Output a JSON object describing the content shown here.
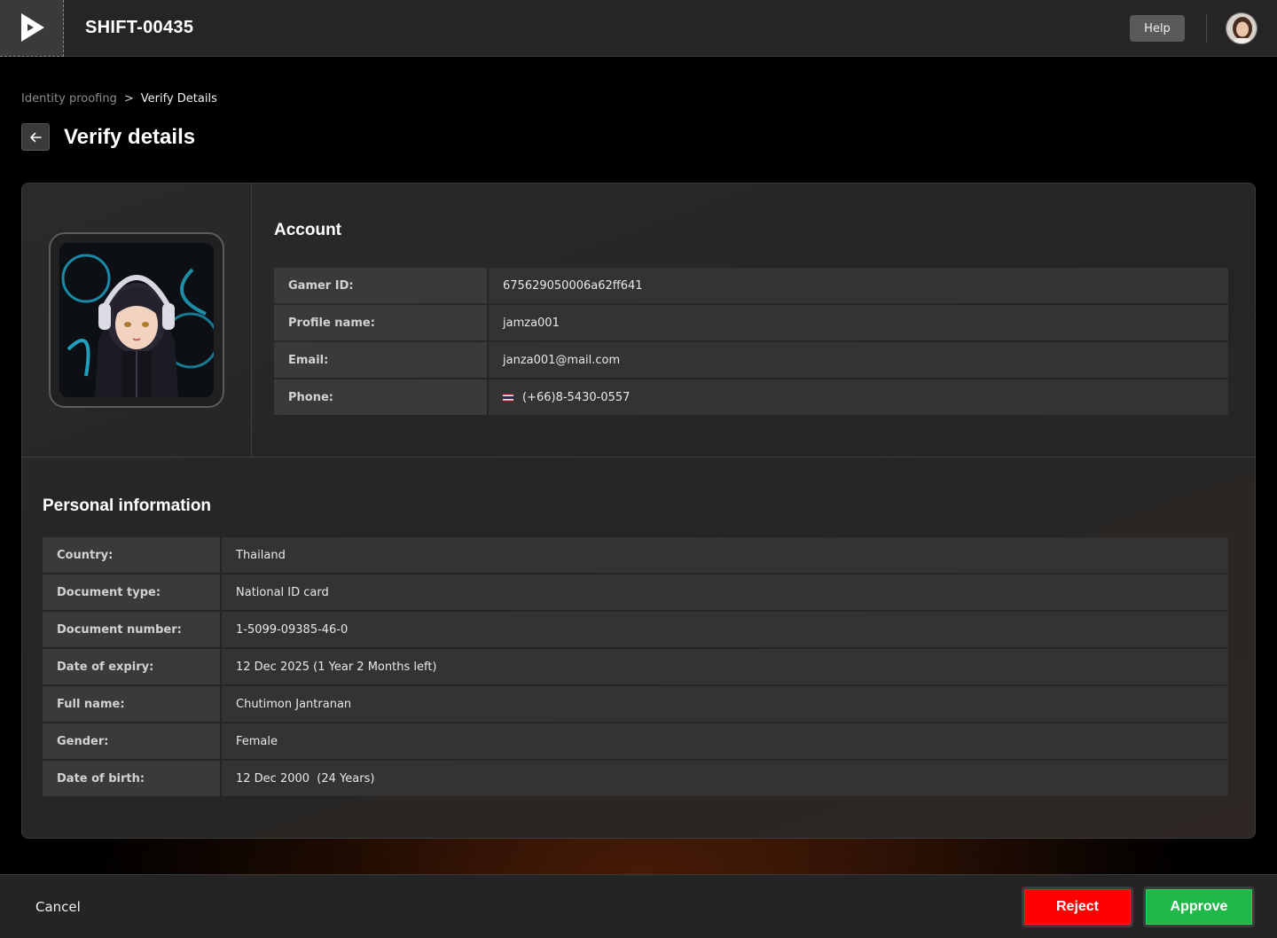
{
  "header": {
    "title": "SHIFT-00435",
    "help_label": "Help"
  },
  "breadcrumb": {
    "parent": "Identity proofing",
    "separator": ">",
    "current": "Verify Details"
  },
  "page": {
    "title": "Verify details"
  },
  "account": {
    "title": "Account",
    "rows": [
      {
        "label": "Gamer ID:",
        "value": "675629050006a62ff641"
      },
      {
        "label": "Profile name:",
        "value": "jamza001"
      },
      {
        "label": "Email:",
        "value": "janza001@mail.com"
      },
      {
        "label": "Phone:",
        "value": "(+66)8-5430-0557",
        "flag": "thailand-flag-icon"
      }
    ]
  },
  "personal": {
    "title": "Personal information",
    "rows": [
      {
        "label": "Country:",
        "value": "Thailand"
      },
      {
        "label": "Document type:",
        "value": "National ID card"
      },
      {
        "label": "Document number:",
        "value": "1-5099-09385-46-0"
      },
      {
        "label": "Date of expiry:",
        "value": "12 Dec 2025 (1 Year 2 Months left)"
      },
      {
        "label": "Full name:",
        "value": "Chutimon Jantranan"
      },
      {
        "label": "Gender:",
        "value": "Female"
      },
      {
        "label": "Date of birth:",
        "value": "12 Dec 2000  (24 Years)"
      }
    ]
  },
  "footer": {
    "cancel_label": "Cancel",
    "reject_label": "Reject",
    "approve_label": "Approve"
  },
  "colors": {
    "reject": "#ff0000",
    "approve": "#21b84a",
    "header_bg": "#252525",
    "card_bg": "#2a2a2a"
  },
  "icons": {
    "logo": "play-logo-icon",
    "back": "arrow-left-icon"
  }
}
